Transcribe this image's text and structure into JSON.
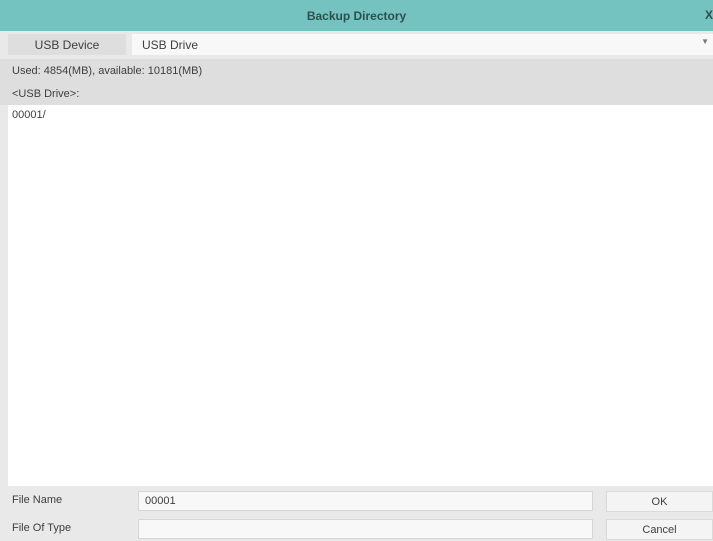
{
  "window": {
    "title": "Backup Directory",
    "close_glyph": "X"
  },
  "device": {
    "label": "USB Device",
    "selected": "USB Drive",
    "dropdown_icon": "chevron-down-icon"
  },
  "storage": {
    "usage_text": "Used: 4854(MB), available: 10181(MB)"
  },
  "current_path": "<USB Drive>:",
  "files": [
    {
      "name": "00001/"
    }
  ],
  "form": {
    "file_name_label": "File Name",
    "file_name_value": "00001",
    "file_type_label": "File Of Type",
    "file_type_value": ""
  },
  "buttons": {
    "ok": "OK",
    "cancel": "Cancel"
  },
  "colors": {
    "title_bar": "#75c3c0",
    "background": "#e9e9e9",
    "list_background": "#ffffff"
  }
}
